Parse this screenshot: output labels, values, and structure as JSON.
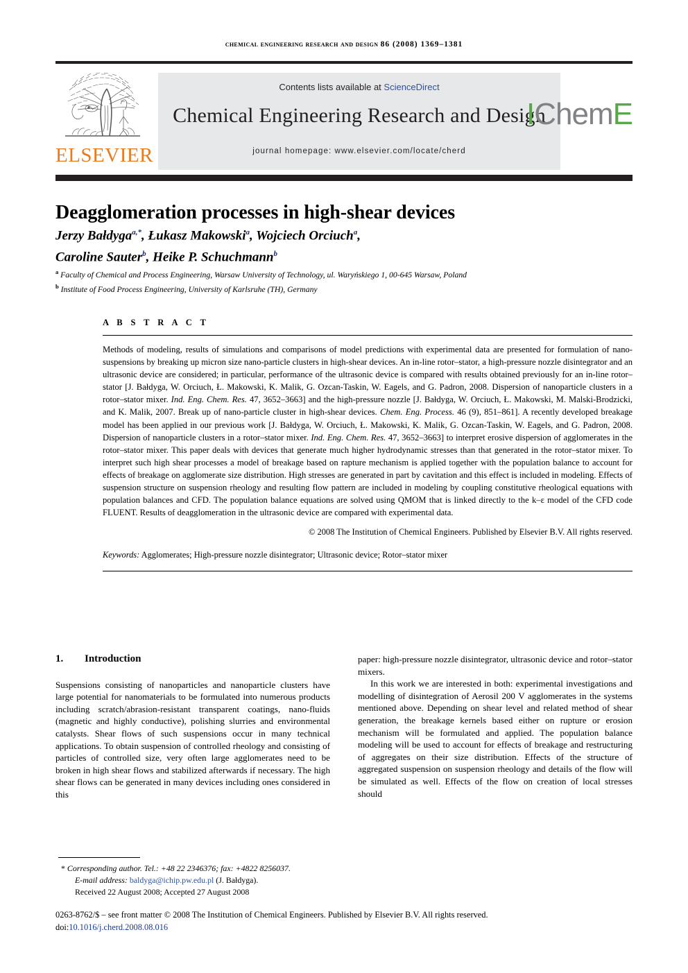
{
  "running_head": {
    "journal": "Chemical Engineering Research and Design",
    "volume_year_pages": "86 (2008) 1369–1381"
  },
  "masthead": {
    "publisher_logo_text": "ELSEVIER",
    "contents_prefix": "Contents lists available at ",
    "contents_link": "ScienceDirect",
    "journal_title": "Chemical Engineering Research and Design",
    "homepage": "journal homepage: www.elsevier.com/locate/cherd",
    "society_logo": {
      "part1": "I",
      "part2": "Chem",
      "part3": "E"
    },
    "colors": {
      "elsevier_orange": "#E87B1E",
      "link_blue": "#2b50a1",
      "icheme_green": "#5aa64b",
      "icheme_gray": "#808285",
      "band_gray": "#e7e8e9",
      "rule_black": "#231f20"
    }
  },
  "article": {
    "title": "Deagglomeration processes in high-shear devices",
    "authors_line1": "Jerzy Bałdyga",
    "authors_line1_sup": "a,*",
    "authors_line1_b": ", Łukasz Makowski",
    "authors_line1_sup2": "a",
    "authors_line1_c": ", Wojciech Orciuch",
    "authors_line1_sup3": "a",
    "authors_line1_d": ",",
    "authors_line2": "Caroline Sauter",
    "authors_line2_sup": "b",
    "authors_line2_b": ", Heike P. Schuchmann",
    "authors_line2_sup2": "b",
    "affiliation_a_marker": "a",
    "affiliation_a": " Faculty of Chemical and Process Engineering, Warsaw University of Technology, ul. Waryńskiego 1, 00-645 Warsaw, Poland",
    "affiliation_b_marker": "b",
    "affiliation_b": " Institute of Food Process Engineering, University of Karlsruhe (TH), Germany"
  },
  "abstract": {
    "label": "A B S T R A C T",
    "paragraph_1": "Methods of modeling, results of simulations and comparisons of model predictions with experimental data are presented for formulation of nano-suspensions by breaking up micron size nano-particle clusters in high-shear devices. An in-line rotor–stator, a high-pressure nozzle disintegrator and an ultrasonic device are considered; in particular, performance of the ultrasonic device is compared with results obtained previously for an in-line rotor–stator [J. Bałdyga, W. Orciuch, Ł. Makowski, K. Malik, G. Ozcan-Taskin, W. Eagels, and G. Padron, 2008. Dispersion of nanoparticle clusters in a rotor–stator mixer. ",
    "italic_1": "Ind. Eng. Chem. Res.",
    "paragraph_1b": " 47, 3652–3663] and the high-pressure nozzle [J. Bałdyga, W. Orciuch, Ł. Makowski, M. Malski-Brodzicki, and K. Malik, 2007. Break up of nano-particle cluster in high-shear devices. ",
    "italic_2": "Chem. Eng. Process.",
    "paragraph_1c": " 46 (9), 851–861]. A recently developed breakage model has been applied in our previous work [J. Bałdyga, W. Orciuch, Ł. Makowski, K. Malik, G. Ozcan-Taskin, W. Eagels, and G. Padron, 2008. Dispersion of nanoparticle clusters in a rotor–stator mixer. ",
    "italic_3": "Ind. Eng. Chem. Res.",
    "paragraph_1d": " 47, 3652–3663] to interpret erosive dispersion of agglomerates in the rotor–stator mixer. This paper deals with devices that generate much higher hydrodynamic stresses than that generated in the rotor–stator mixer. To interpret such high shear processes a model of breakage based on rapture mechanism is applied together with the population balance to account for effects of breakage on agglomerate size distribution. High stresses are generated in part by cavitation and this effect is included in modeling. Effects of suspension structure on suspension rheology and resulting flow pattern are included in modeling by coupling constitutive rheological equations with population balances and CFD. The population balance equations are solved using QMOM that is linked directly to the k–ε model of the CFD code FLUENT. Results of deagglomeration in the ultrasonic device are compared with experimental data.",
    "copyright": "© 2008 The Institution of Chemical Engineers. Published by Elsevier B.V. All rights reserved.",
    "keywords_label": "Keywords:",
    "keywords_value": "  Agglomerates; High-pressure nozzle disintegrator; Ultrasonic device; Rotor–stator mixer"
  },
  "body": {
    "section_number": "1.",
    "section_title": "Introduction",
    "left_paragraph": "Suspensions consisting of nanoparticles and nanoparticle clusters have large potential for nanomaterials to be formulated into numerous products including scratch/abrasion-resistant transparent coatings, nano-fluids (magnetic and highly conductive), polishing slurries and environmental catalysts. Shear flows of such suspensions occur in many technical applications. To obtain suspension of controlled rheology and consisting of particles of controlled size, very often large agglomerates need to be broken in high shear flows and stabilized afterwards if necessary. The high shear flows can be generated in many devices including ones considered in this",
    "right_paragraph_1": "paper: high-pressure nozzle disintegrator, ultrasonic device and rotor–stator mixers.",
    "right_paragraph_2": "In this work we are interested in both: experimental investigations and modelling of disintegration of Aerosil 200 V agglomerates in the systems mentioned above. Depending on shear level and related method of shear generation, the breakage kernels based either on rupture or erosion mechanism will be formulated and applied. The population balance modeling will be used to account for effects of breakage and restructuring of aggregates on their size distribution. Effects of the structure of aggregated suspension on suspension rheology and details of the flow will be simulated as well. Effects of the flow on creation of local stresses should"
  },
  "footer": {
    "corresponding_star": "*",
    "corresponding_text": " Corresponding author. Tel.: +48 22 2346376; fax: +4822 8256037.",
    "email_label": "E-mail address:",
    "email_value": " baldyga@ichip.pw.edu.pl",
    "email_suffix": " (J. Bałdyga).",
    "received": "Received 22 August 2008; Accepted 27 August 2008",
    "front_matter": "0263-8762/$ – see front matter © 2008 The Institution of Chemical Engineers. Published by Elsevier B.V. All rights reserved.",
    "doi_label": "doi:",
    "doi_value": "10.1016/j.cherd.2008.08.016"
  }
}
